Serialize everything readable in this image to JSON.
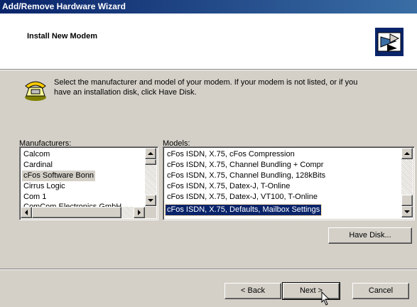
{
  "window": {
    "title": "Add/Remove Hardware Wizard"
  },
  "header": {
    "title": "Install New Modem",
    "icon": "hardware-wizard-icon"
  },
  "instructions": {
    "line1": "Select the manufacturer and model of your modem. If your modem is not listed, or if you",
    "line2": "have an installation disk, click Have Disk.",
    "icon": "phone-modem-icon"
  },
  "manufacturers": {
    "label": "Manufacturers:",
    "items": [
      "Calcom",
      "Cardinal",
      "cFos Software Bonn",
      "Cirrus Logic",
      "Com 1",
      "ComCom Electronics GmbH"
    ],
    "selected": "cFos Software Bonn"
  },
  "models": {
    "label": "Models:",
    "items": [
      "cFos ISDN, X.75, cFos Compression",
      "cFos ISDN, X.75, Channel Bundling + Compr",
      "cFos ISDN, X.75, Channel Bundling, 128kBits",
      "cFos ISDN, X.75, Datex-J, T-Online",
      "cFos ISDN, X.75, Datex-J, VT100, T-Online",
      "cFos ISDN, X.75, Defaults, Mailbox Settings"
    ],
    "selected": "cFos ISDN, X.75, Defaults, Mailbox Settings"
  },
  "buttons": {
    "have_disk": "Have Disk...",
    "back": "< Back",
    "next": "Next >",
    "cancel": "Cancel"
  }
}
